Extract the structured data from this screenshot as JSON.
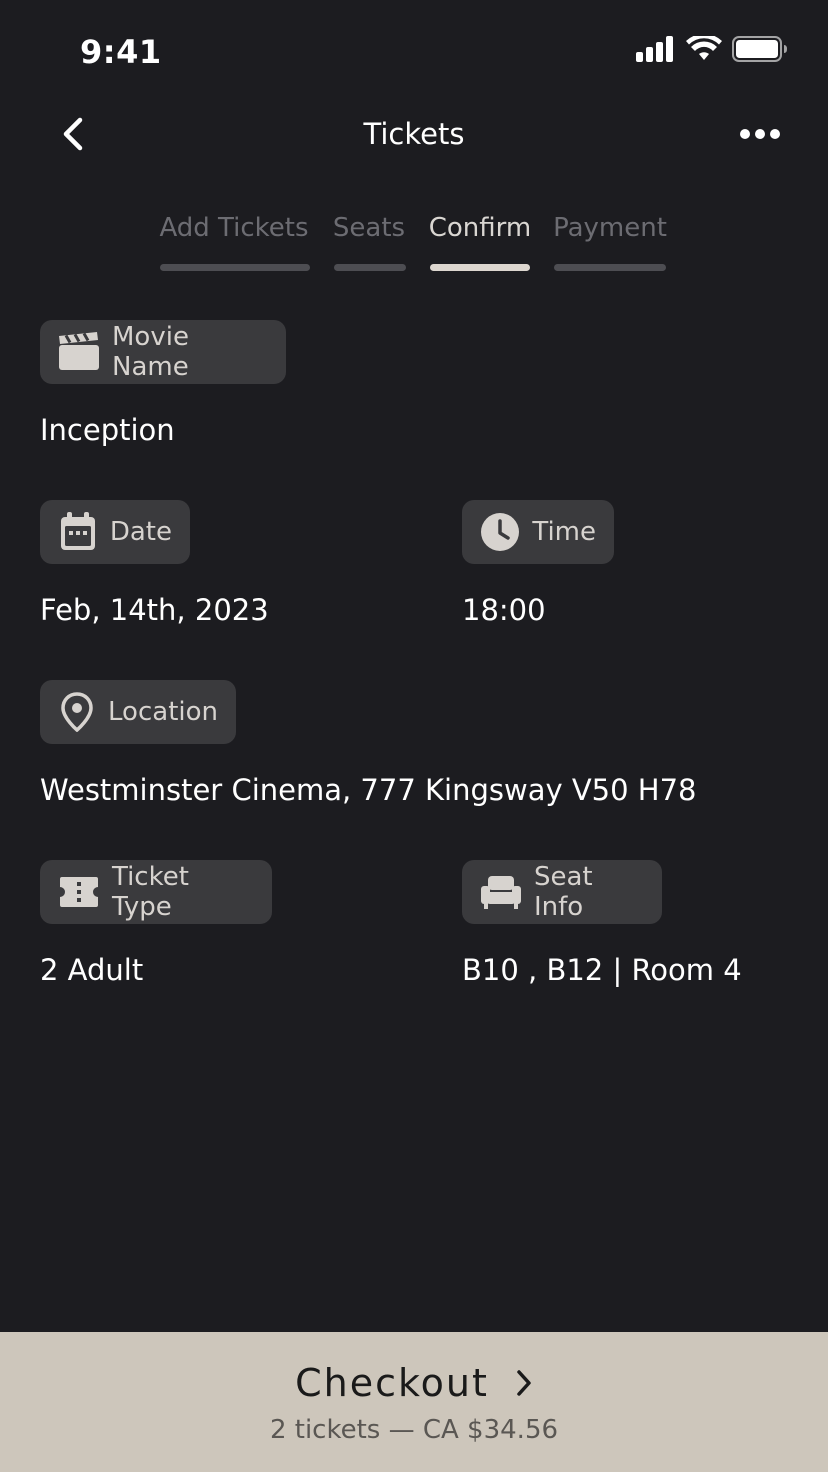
{
  "status_bar": {
    "time": "9:41",
    "icons": [
      "signal-icon",
      "wifi-icon",
      "battery-icon"
    ]
  },
  "nav": {
    "title": "Tickets",
    "back_icon": "chevron-left-icon",
    "more_icon": "more-horizontal-icon"
  },
  "steps": [
    {
      "label": "Add Tickets",
      "active": false
    },
    {
      "label": "Seats",
      "active": false
    },
    {
      "label": "Confirm",
      "active": true
    },
    {
      "label": "Payment",
      "active": false
    }
  ],
  "details": {
    "movie": {
      "label": "Movie Name",
      "value": "Inception",
      "icon": "clapperboard-icon"
    },
    "date": {
      "label": "Date",
      "value": "Feb, 14th, 2023",
      "icon": "calendar-icon"
    },
    "time": {
      "label": "Time",
      "value": "18:00",
      "icon": "clock-icon"
    },
    "location": {
      "label": "Location",
      "value": "Westminster Cinema, 777 Kingsway V50 H78",
      "icon": "location-pin-icon"
    },
    "ticket_type": {
      "label": "Ticket Type",
      "value": "2 Adult",
      "icon": "ticket-icon"
    },
    "seat_info": {
      "label": "Seat Info",
      "value": "B10 , B12 | Room 4",
      "icon": "armchair-icon"
    }
  },
  "checkout": {
    "label": "Checkout",
    "summary": "2 tickets — CA $34.56"
  },
  "colors": {
    "background": "#1c1c20",
    "chip": "#3a3a3d",
    "accent": "#cdc6bb"
  }
}
